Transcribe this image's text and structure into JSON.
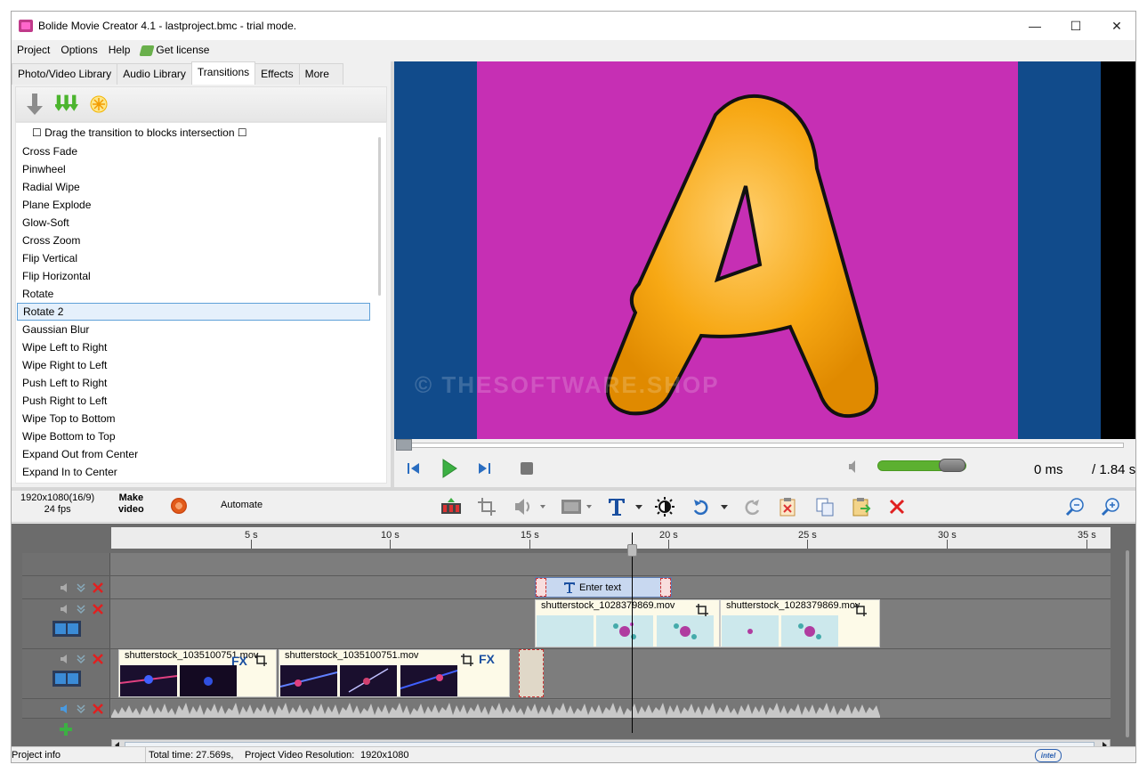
{
  "window": {
    "title": "Bolide Movie Creator 4.1 - lastproject.bmc  - trial mode."
  },
  "menu": {
    "project": "Project",
    "options": "Options",
    "help": "Help",
    "license": "Get license"
  },
  "tabs": [
    "Photo/Video Library",
    "Audio Library",
    "Transitions",
    "Effects",
    "More"
  ],
  "active_tab": "Transitions",
  "transitions": {
    "hint": "☐ Drag the transition to blocks intersection ☐",
    "items": [
      "Cross Fade",
      "Pinwheel",
      "Radial Wipe",
      "Plane Explode",
      "Glow-Soft",
      "Cross Zoom",
      "Flip Vertical",
      "Flip Horizontal",
      "Rotate",
      "Rotate 2",
      "Gaussian Blur",
      "Wipe Left to Right",
      "Wipe Right to Left",
      "Push Left to Right",
      "Push Right to Left",
      "Wipe Top to Bottom",
      "Wipe Bottom to Top",
      "Expand Out from Center",
      "Expand In to Center"
    ],
    "selected": "Rotate 2"
  },
  "preview": {
    "watermark": "© THESOFTWARE.SHOP",
    "letter": "A"
  },
  "player": {
    "time_current": "0 ms",
    "time_total": "/ 1.84 s",
    "volume": 0.7
  },
  "timeline_toolbar": {
    "resolution": "1920x1080(16/9)",
    "fps": "24 fps",
    "make_video_1": "Make",
    "make_video_2": "video",
    "automate": "Automate"
  },
  "ruler": [
    "5 s",
    "10 s",
    "15 s",
    "20 s",
    "25 s",
    "30 s",
    "35 s"
  ],
  "text_clip": "Enter text",
  "clips": {
    "video_track_1": [
      "shutterstock_1028379869.mov",
      "shutterstock_1028379869.mov"
    ],
    "video_track_2": [
      "shutterstock_1035100751.mov",
      "shutterstock_1035100751.mov"
    ],
    "fx": "FX"
  },
  "status": {
    "project_info": "Project info",
    "total_time": "Total time: 27.569s,",
    "resolution_label": "Project Video Resolution:",
    "resolution_value": "1920x1080",
    "badge": "intel"
  },
  "colors": {
    "preview_bg": "#114b8b",
    "canvas": "#c62fb4",
    "letter": "#f5a810",
    "accent": "#5cb030"
  }
}
